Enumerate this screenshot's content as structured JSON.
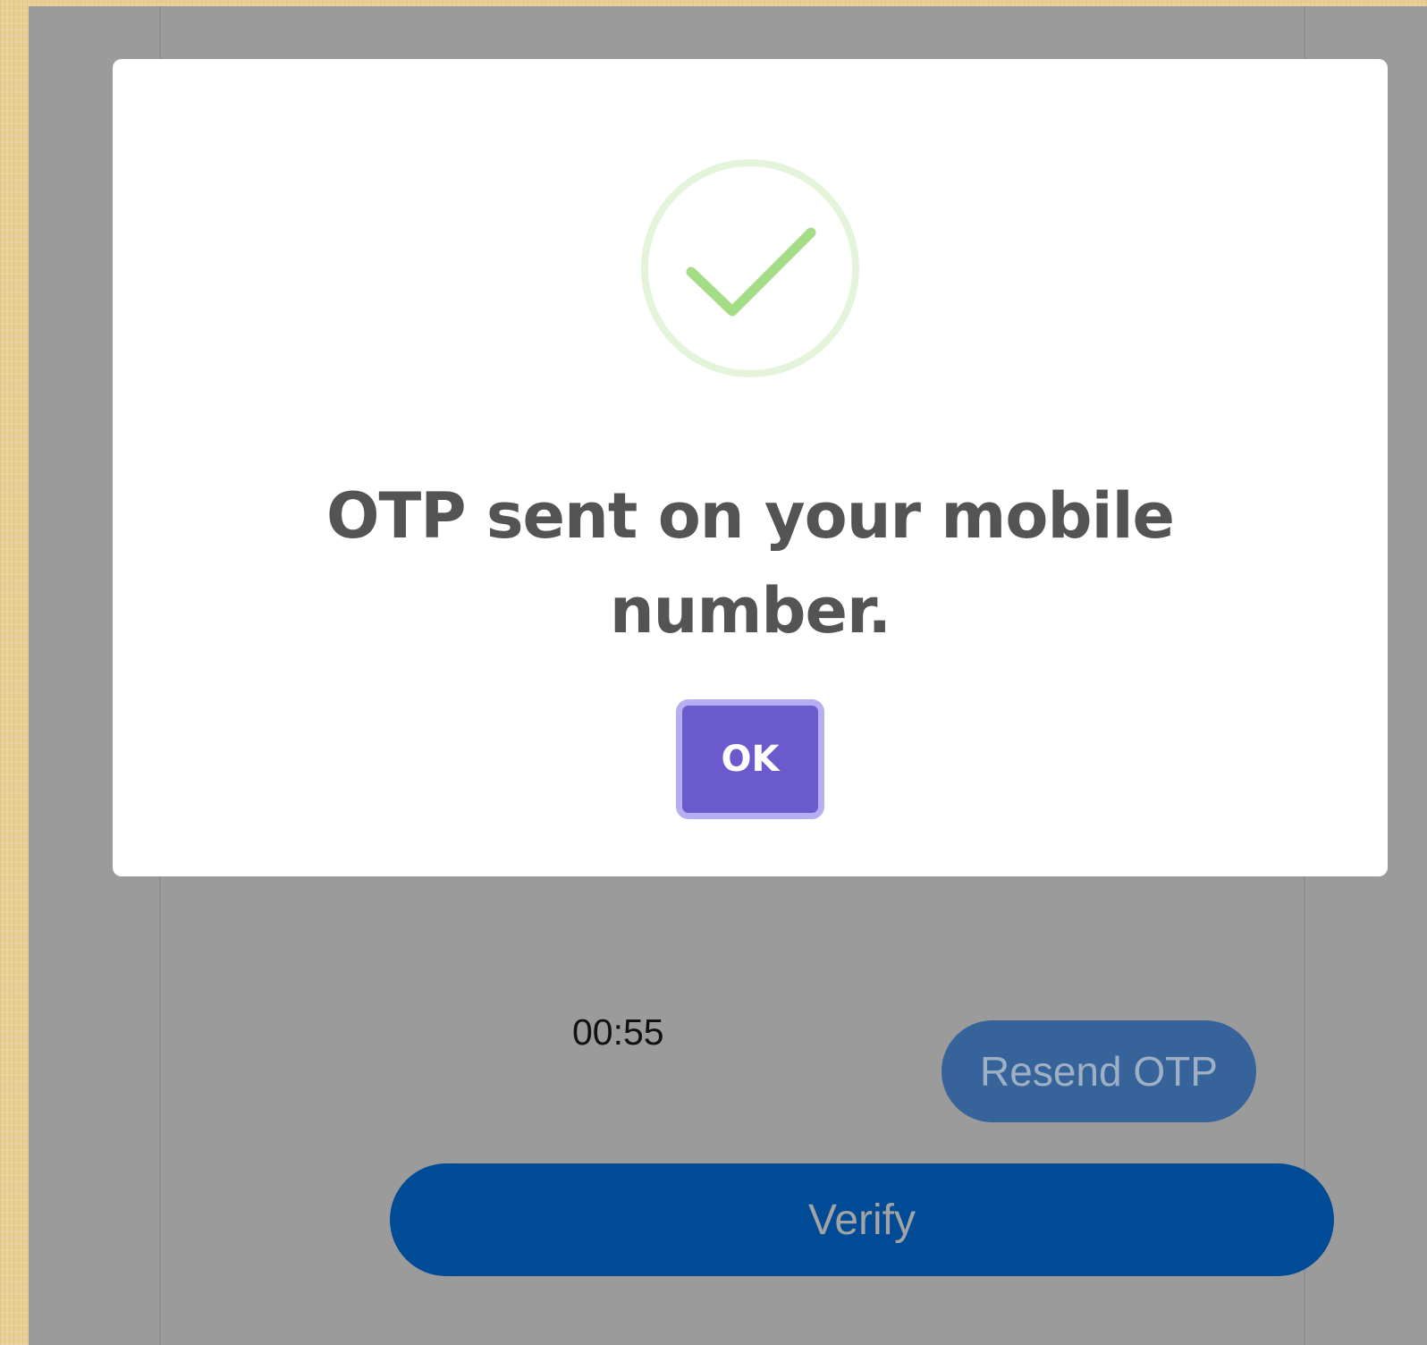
{
  "background_form": {
    "timer": "00:55",
    "resend_label": "Resend OTP",
    "verify_label": "Verify"
  },
  "modal": {
    "icon": "success-check-icon",
    "title": "OTP sent on your mobile number.",
    "ok_label": "OK"
  },
  "colors": {
    "overlay": "#9b9b9b",
    "accent": "#6a5acd",
    "success": "#a5dc86",
    "primary": "#004b96"
  }
}
